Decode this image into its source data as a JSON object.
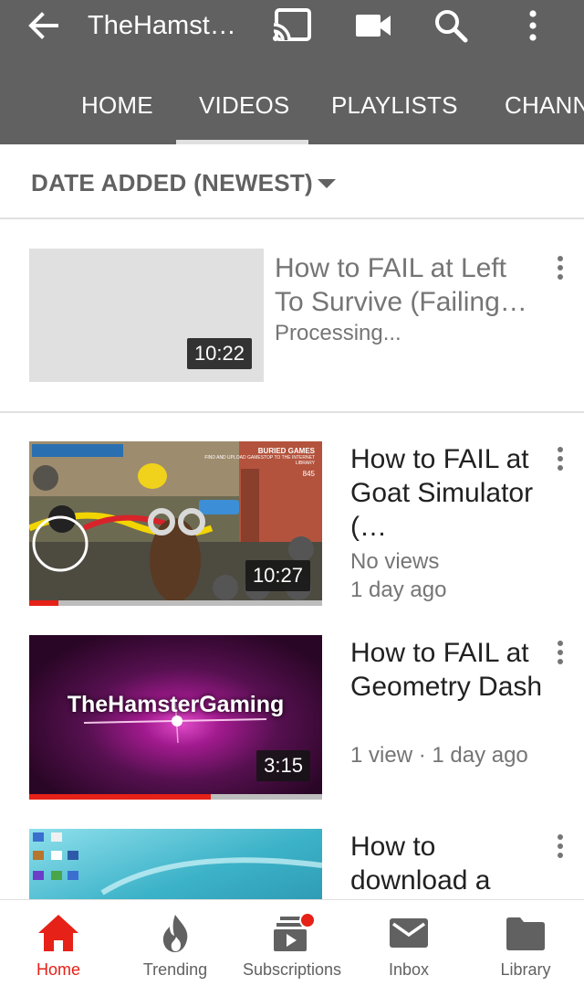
{
  "appbar": {
    "title": "TheHamst…",
    "icons": [
      "back-arrow-icon",
      "cast-icon",
      "video-camera-icon",
      "search-icon",
      "more-vert-icon"
    ]
  },
  "tabs": [
    {
      "label": "HOME",
      "selected": false
    },
    {
      "label": "VIDEOS",
      "selected": true
    },
    {
      "label": "PLAYLISTS",
      "selected": false
    },
    {
      "label": "CHANN",
      "selected": false
    }
  ],
  "sort": {
    "label": "DATE ADDED (NEWEST)"
  },
  "videos": [
    {
      "title": "How to FAIL at Left To Survive (Failing…",
      "status": "Processing...",
      "duration": "10:22",
      "progress": null
    },
    {
      "title": "How to FAIL at Goat Simulator (…",
      "views": "No views",
      "age": "1 day ago",
      "duration": "10:27",
      "progress": 0.1,
      "thumb_overlay_text": [
        "BURIED GAMES",
        "FIND AND UPLOAD GAMESTOP TO THE INTERNET LIBRARY",
        "845"
      ]
    },
    {
      "title": "How to FAIL at Geometry Dash",
      "meta": "1 view · 1 day ago",
      "duration": "3:15",
      "progress": 0.62,
      "thumb_text": "TheHamsterGaming"
    },
    {
      "title": "How to download a",
      "progress": null
    }
  ],
  "bottomnav": [
    {
      "label": "Home",
      "icon": "home-icon",
      "active": true
    },
    {
      "label": "Trending",
      "icon": "flame-icon",
      "active": false
    },
    {
      "label": "Subscriptions",
      "icon": "subscriptions-icon",
      "active": false,
      "badge": true
    },
    {
      "label": "Inbox",
      "icon": "mail-icon",
      "active": false
    },
    {
      "label": "Library",
      "icon": "folder-icon",
      "active": false
    }
  ],
  "colors": {
    "appbar": "#616161",
    "accent": "#e62117",
    "muted": "#757575"
  }
}
